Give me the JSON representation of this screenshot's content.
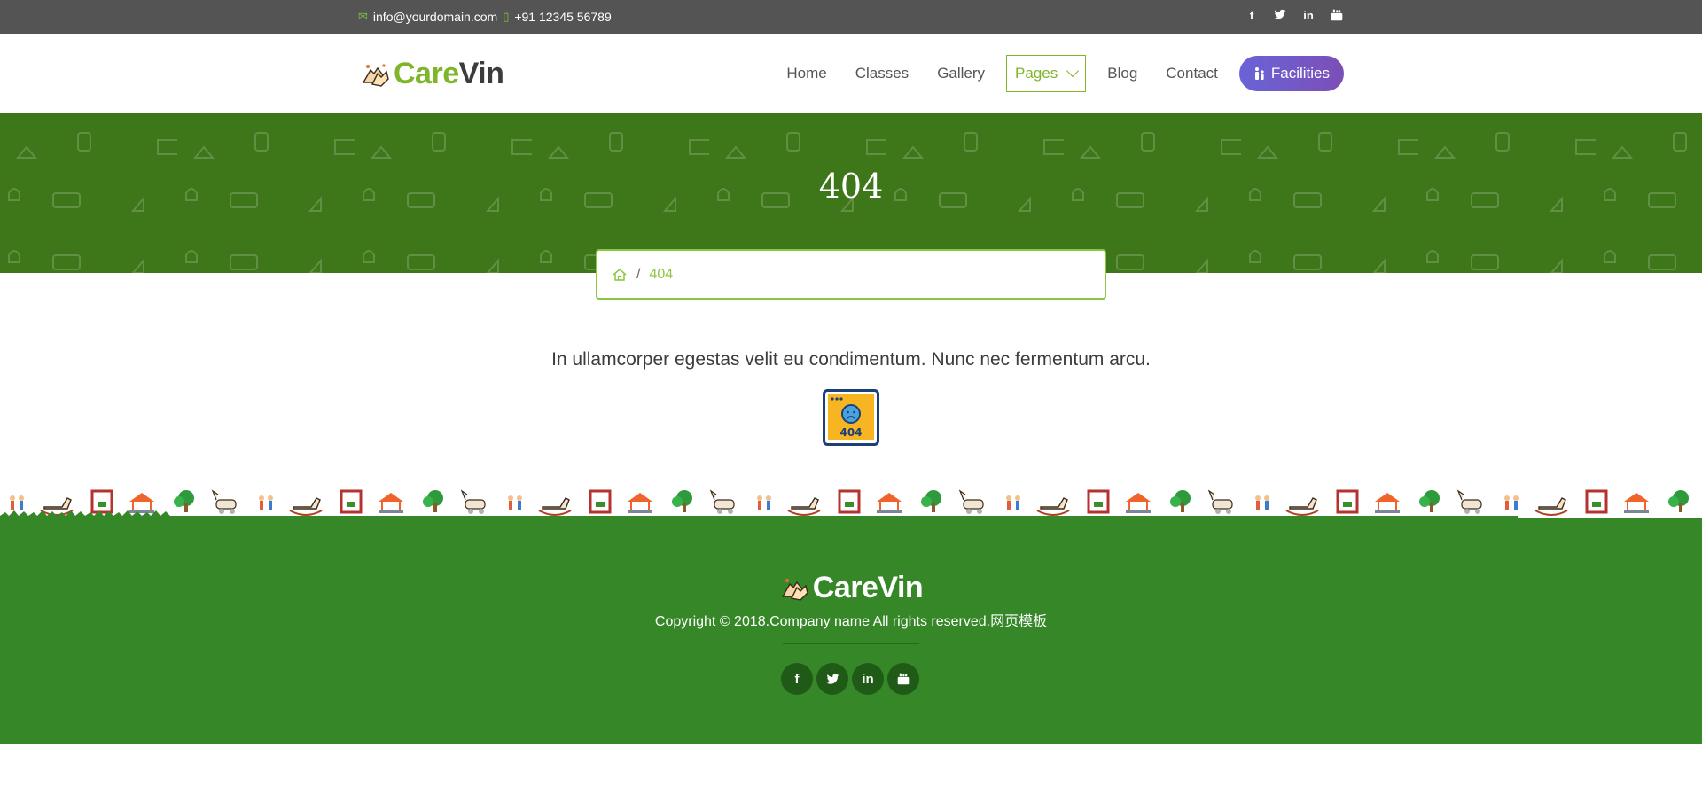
{
  "topbar": {
    "email": "info@yourdomain.com",
    "phone": "+91 12345 56789",
    "social": [
      {
        "icon": "facebook-icon",
        "glyph": "f"
      },
      {
        "icon": "twitter-icon",
        "glyph": "t"
      },
      {
        "icon": "linkedin-icon",
        "glyph": "in"
      },
      {
        "icon": "youtube-icon",
        "glyph": "▶"
      }
    ]
  },
  "brand": {
    "part1": "Care",
    "part2": "Vin",
    "accent": "#7fb52b"
  },
  "nav": {
    "items": [
      "Home",
      "Classes",
      "Gallery",
      "Pages",
      "Blog",
      "Contact"
    ],
    "active": "Pages",
    "cta": "Facilities"
  },
  "banner": {
    "title": "404",
    "color": "#3e761a"
  },
  "breadcrumb": {
    "current": "404"
  },
  "main": {
    "message": "In ullamcorper egestas velit eu condimentum. Nunc nec fermentum arcu.",
    "icon": "404-error-icon"
  },
  "footer": {
    "copyright": "Copyright © 2018.Company name All rights reserved.网页模板",
    "color": "#358728"
  }
}
